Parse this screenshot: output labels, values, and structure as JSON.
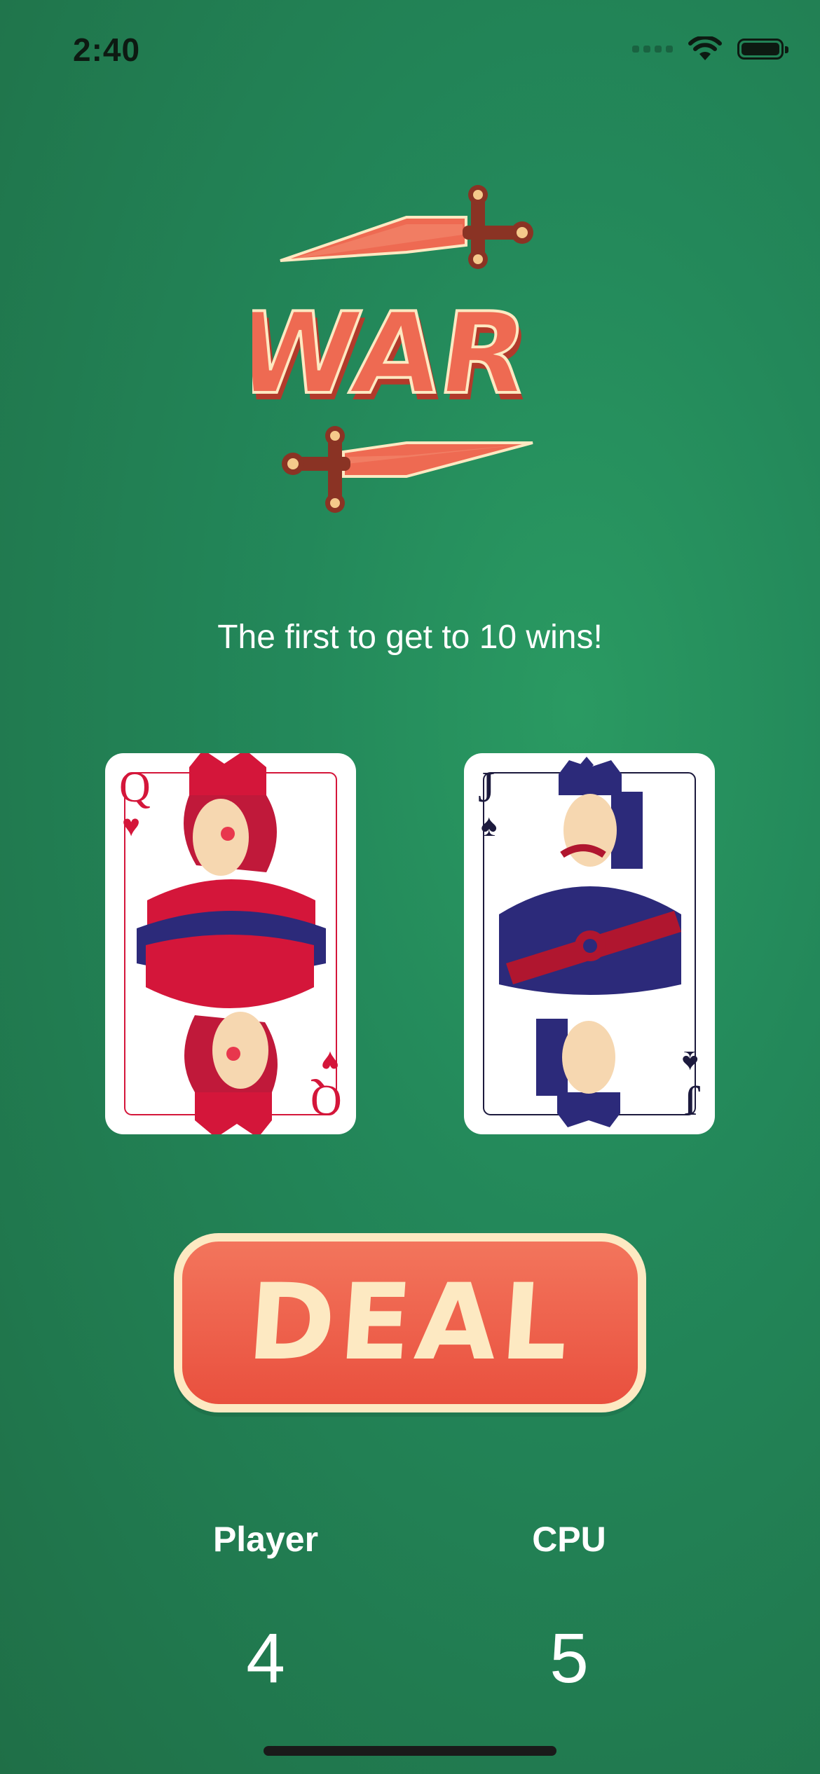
{
  "status_bar": {
    "time": "2:40",
    "icons": [
      "signal-icon",
      "wifi-icon",
      "battery-icon"
    ]
  },
  "logo": {
    "text": "WAR"
  },
  "tagline": "The first to get to 10 wins!",
  "cards": {
    "player": {
      "rank": "Q",
      "suit": "♥",
      "suit_name": "hearts"
    },
    "cpu": {
      "rank": "J",
      "suit": "♠",
      "suit_name": "spades"
    }
  },
  "deal_button": {
    "label": "DEAL"
  },
  "scores": {
    "player_label": "Player",
    "player_value": "4",
    "cpu_label": "CPU",
    "cpu_value": "5"
  },
  "colors": {
    "background": "#23885a",
    "accent": "#ee5d48",
    "cream": "#fde9c2",
    "card_red": "#d4163a",
    "card_navy": "#1c1a3d"
  }
}
